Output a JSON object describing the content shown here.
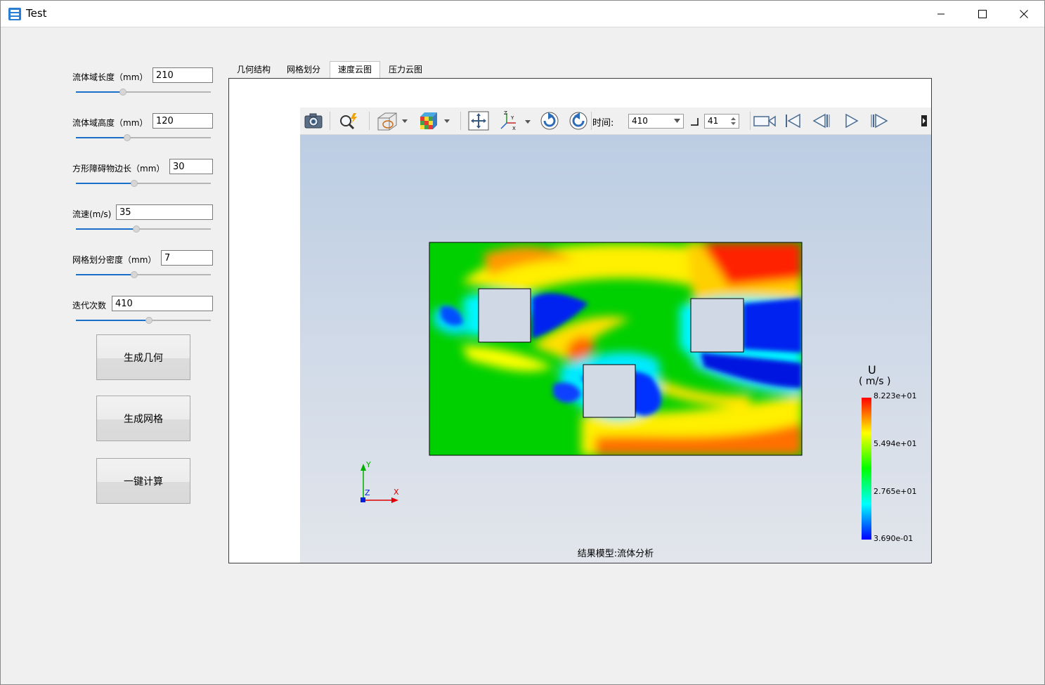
{
  "window": {
    "title": "Test"
  },
  "params": [
    {
      "label": "流体域长度（mm）",
      "value": "210",
      "slider": 0.35
    },
    {
      "label": "流体域高度（mm）",
      "value": "120",
      "slider": 0.38
    },
    {
      "label": "方形障碍物边长（mm）",
      "value": "30",
      "slider": 0.43
    },
    {
      "label": "流速(m/s)",
      "value": "35",
      "slider": 0.45
    },
    {
      "label": "网格划分密度（mm）",
      "value": "7",
      "slider": 0.43
    },
    {
      "label": "迭代次数",
      "value": "410",
      "slider": 0.54
    }
  ],
  "buttons": {
    "geometry": "生成几何",
    "mesh": "生成网格",
    "compute": "一键计算"
  },
  "tabs": [
    {
      "label": "几何结构"
    },
    {
      "label": "网格划分"
    },
    {
      "label": "速度云图"
    },
    {
      "label": "压力云图"
    }
  ],
  "toolbar": {
    "time_label": "时间:",
    "time_value": "410",
    "step_value": "41"
  },
  "icons": [
    "camera-icon",
    "zoom-icon",
    "display-mode-icon",
    "color-cube-icon",
    "pan-icon",
    "axes-icon",
    "rotate-cw-icon",
    "rotate-ccw-icon",
    "record-icon",
    "first-frame-icon",
    "prev-frame-icon",
    "play-icon",
    "next-frame-icon"
  ],
  "legend": {
    "title": "U",
    "unit": "( m/s )",
    "max": "8.223e+01",
    "mid_high": "5.494e+01",
    "mid_low": "2.765e+01",
    "min": "3.690e-01"
  },
  "axes": {
    "x": "X",
    "y": "Y",
    "z": "Z"
  },
  "caption": "结果模型:流体分析"
}
